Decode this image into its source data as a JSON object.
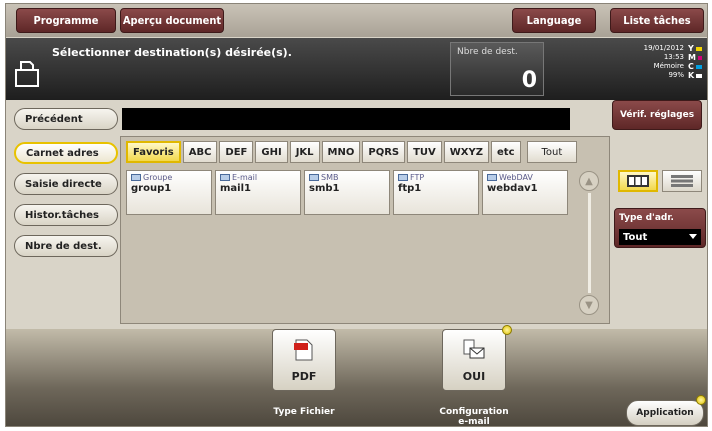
{
  "topbar": {
    "programme_label": "Programme",
    "apercu_label": "Aperçu document",
    "language_label": "Language",
    "liste_label": "Liste tâches"
  },
  "status": {
    "message": "Sélectionner destination(s) désirée(s).",
    "dest_label": "Nbre de dest.",
    "dest_count": "0",
    "date": "19/01/2012",
    "time": "13:53",
    "memory_label": "Mémoire",
    "memory_value": "99%",
    "toner_letters": [
      "Y",
      "M",
      "C",
      "K"
    ],
    "toner_colors": [
      "#f2d400",
      "#d4007a",
      "#00a0e0",
      "#ffffff"
    ]
  },
  "left_nav": {
    "precedent_label": "Précédent",
    "items": [
      {
        "label": "Carnet adres"
      },
      {
        "label": "Saisie directe"
      },
      {
        "label": "Histor.tâches"
      },
      {
        "label": "Nbre de dest."
      }
    ]
  },
  "verif_label": "Vérif. réglages",
  "tabs": [
    "Favoris",
    "ABC",
    "DEF",
    "GHI",
    "JKL",
    "MNO",
    "PQRS",
    "TUV",
    "WXYZ",
    "etc",
    "Tout"
  ],
  "cards": [
    {
      "type": "Groupe",
      "name": "group1",
      "icon": "group-icon"
    },
    {
      "type": "E-mail",
      "name": "mail1",
      "icon": "email-icon"
    },
    {
      "type": "SMB",
      "name": "smb1",
      "icon": "smb-icon"
    },
    {
      "type": "FTP",
      "name": "ftp1",
      "icon": "ftp-icon"
    },
    {
      "type": "WebDAV",
      "name": "webdav1",
      "icon": "webdav-icon"
    }
  ],
  "type_adr": {
    "label": "Type d'adr.",
    "value": "Tout"
  },
  "bottom": {
    "pdf_value": "PDF",
    "pdf_caption": "Type Fichier",
    "email_value": "OUI",
    "email_caption_1": "Configuration",
    "email_caption_2": "e-mail",
    "application_label": "Application"
  },
  "colors": {
    "accent_button": "#6e3434",
    "highlight": "#e0b800"
  }
}
